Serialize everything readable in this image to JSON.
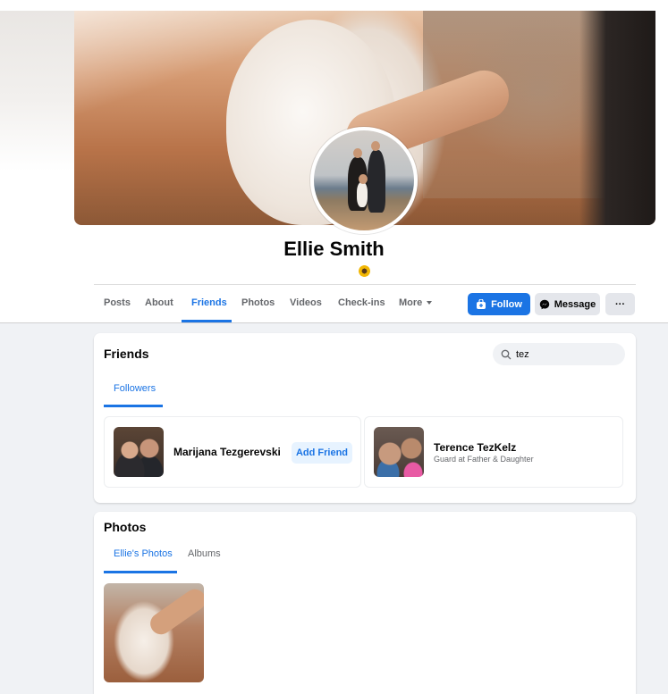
{
  "profile": {
    "name": "Ellie Smith",
    "tabs": [
      "Posts",
      "About",
      "Friends",
      "Photos",
      "Videos",
      "Check-ins",
      "More"
    ],
    "active_tab": "Friends",
    "buttons": {
      "follow": "Follow",
      "message": "Message",
      "more": "···"
    }
  },
  "friends_section": {
    "title": "Friends",
    "search_value": "tez",
    "subtab": "Followers",
    "people": [
      {
        "name": "Marijana Tezgerevski",
        "action": "Add Friend"
      },
      {
        "name": "Terence TezKelz",
        "subtitle": "Guard at Father & Daughter"
      }
    ]
  },
  "photos_section": {
    "title": "Photos",
    "subtabs": [
      "Ellie's Photos",
      "Albums"
    ],
    "active_subtab": "Ellie's Photos"
  },
  "colors": {
    "accent": "#1b74e4",
    "button_gray": "#e4e6eb",
    "page_bg": "#f0f2f5"
  },
  "icons": [
    "sunflower-icon",
    "follow-plus-icon",
    "messenger-icon",
    "search-icon",
    "caret-down-icon"
  ]
}
